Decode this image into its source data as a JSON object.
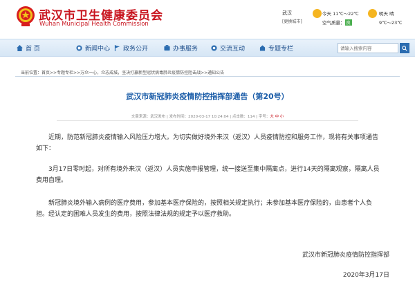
{
  "header": {
    "title": "武汉市卫生健康委员会",
    "subtitle": "Wuhan Municipal Health Commission",
    "location": "武汉",
    "location_switch": "[更换城市]",
    "today_weather": "今天 11℃～22℃",
    "air_quality_label": "空气质量：",
    "air_quality_value": "良",
    "tomorrow_label": "明天 晴",
    "tomorrow_temp": "9℃～23℃",
    "accent": "#c8141e"
  },
  "nav": {
    "items": [
      {
        "label": "首  页",
        "icon": "home-icon"
      },
      {
        "label": "新闻中心",
        "icon": "news-icon"
      },
      {
        "label": "政务公开",
        "icon": "flag-icon"
      },
      {
        "label": "办事服务",
        "icon": "service-icon"
      },
      {
        "label": "交流互动",
        "icon": "chat-icon"
      },
      {
        "label": "专题专栏",
        "icon": "column-icon"
      }
    ],
    "search_placeholder": "请输入搜索内容"
  },
  "breadcrumb": "当前位置：首页>>专题专栏>>万众一心，众志成城，坚决打赢新型冠状病毒肺炎疫情防控阻击战>>通知公告",
  "article": {
    "title": "武汉市新冠肺炎疫情防控指挥部通告（第20号）",
    "meta_source": "文章来源：武汉发布",
    "meta_date": "发布时间：2020-03-17 10:24:04",
    "meta_views": "点击数：114",
    "meta_font": "字号：",
    "meta_font_sizes": "大 中 小",
    "paragraphs": [
      "近期，防范新冠肺炎疫情输入风险压力增大。为切实做好境外来汉（返汉）人员疫情防控和服务工作，现将有关事项通告如下：",
      "3月17日零时起，对所有境外来汉（返汉）人员实施申报管理，统一接送至集中隔离点，进行14天的隔离观察，隔离人员费用自理。",
      "新冠肺炎境外输入病例的医疗费用，参加基本医疗保险的，按照相关规定执行；未参加基本医疗保险的，由患者个人负担。经认定的困难人员发生的费用，按照法律法规的规定予以医疗救助。"
    ],
    "signature": "武汉市新冠肺炎疫情防控指挥部",
    "date": "2020年3月17日"
  }
}
